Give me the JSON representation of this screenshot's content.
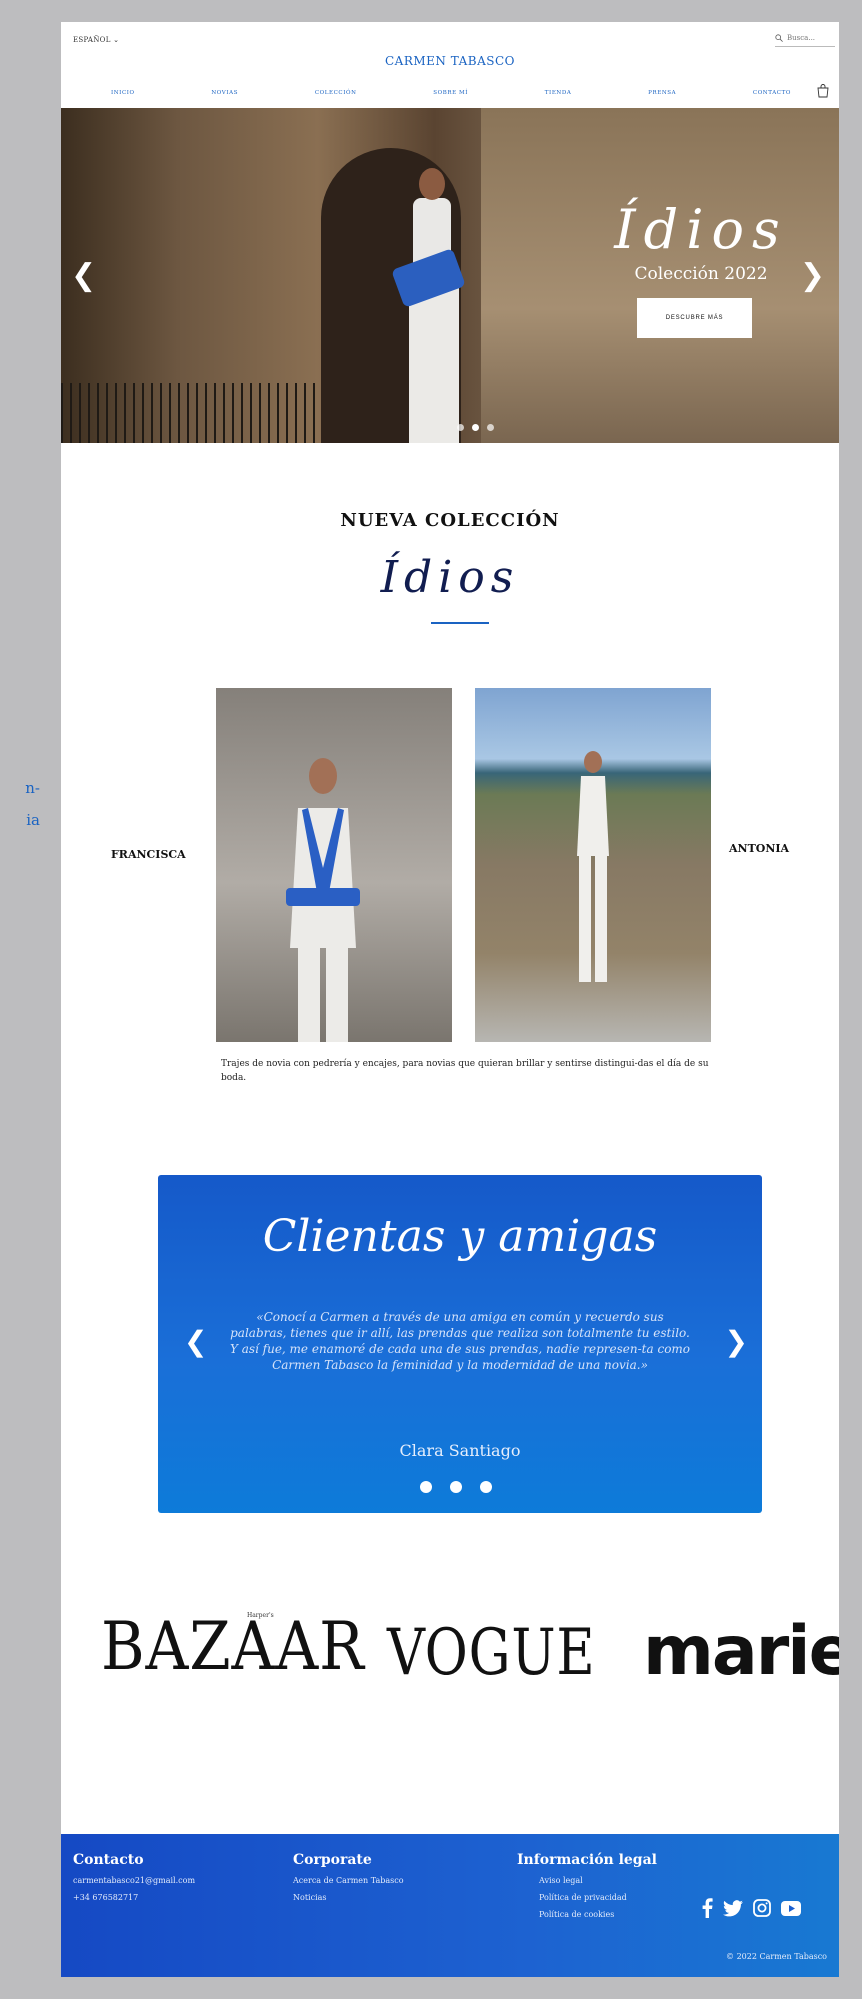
{
  "header": {
    "language": "ESPAÑOL ⌄",
    "search_placeholder": "Busca...",
    "brand": "CARMEN TABASCO",
    "nav": [
      "INICIO",
      "NOVIAS",
      "COLECCIÓN",
      "SOBRE MÍ",
      "TIENDA",
      "PRENSA",
      "CONTACTO"
    ]
  },
  "side_text": {
    "line1": "n-",
    "line2": "ia"
  },
  "hero": {
    "title": "Ídios",
    "subtitle": "Colección 2022",
    "button": "DESCUBRE MÁS",
    "slides_total": 3,
    "active_slide": 2
  },
  "collection": {
    "heading": "NUEVA COLECCIÓN",
    "script_title": "Ídios",
    "left_label": "FRANCISCA",
    "right_label": "ANTONIA",
    "caption": "Trajes de novia con pedrería y encajes, para novias que quieran brillar y sentirse distingui-das el día de su boda."
  },
  "testimonial": {
    "title": "Clientas y amigas",
    "quote": "«Conocí a Carmen a través de una amiga en común y recuerdo sus palabras, tienes que ir allí, las prendas que realiza son totalmente tu estilo. Y así fue, me enamoré de cada una de sus prendas, nadie represen-ta como Carmen Tabasco la feminidad y la modernidad de una novia.»",
    "name": "Clara Santiago",
    "dots": 3
  },
  "press": {
    "bazaar": "BAZAAR",
    "harpers": "Harper's",
    "vogue": "VOGUE",
    "marie": "marie"
  },
  "footer": {
    "contact_title": "Contacto",
    "email": "carmentabasco21@gmail.com",
    "phone": "+34 676582717",
    "corporate_title": "Corporate",
    "about": "Acerca de Carmen Tabasco",
    "news": "Noticias",
    "legal_title": "Información legal",
    "legal_notice": "Aviso legal",
    "privacy": "Política de privacidad",
    "cookies": "Política de cookies",
    "copyright": "© 2022 Carmen Tabasco",
    "social": [
      "facebook-icon",
      "twitter-icon",
      "instagram-icon",
      "youtube-icon"
    ]
  },
  "colors": {
    "brand_blue": "#1a63c2",
    "testimonial_blue": "#1559c9",
    "footer_blue": "#1549c4"
  }
}
